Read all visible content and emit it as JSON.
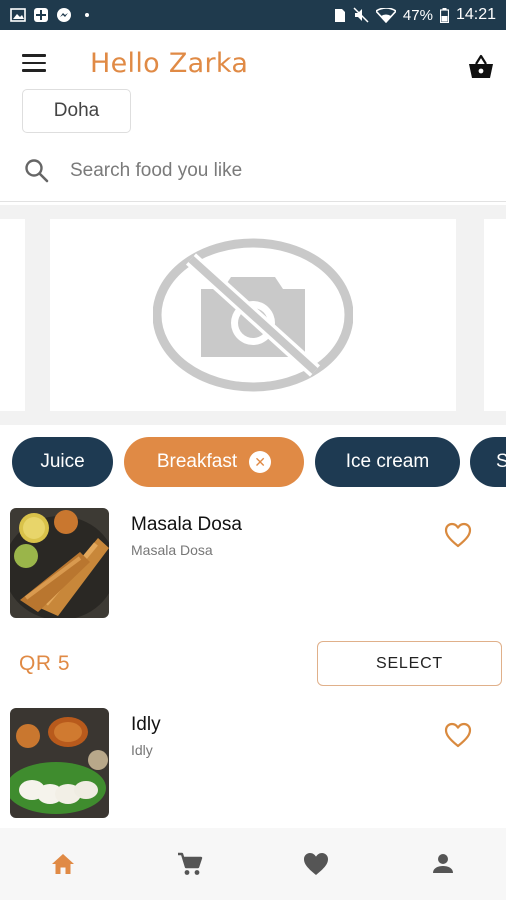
{
  "status_bar": {
    "battery": "47%",
    "time": "14:21"
  },
  "header": {
    "greeting": "Hello Zarka"
  },
  "location": {
    "label": "Doha"
  },
  "search": {
    "placeholder": "Search food you like"
  },
  "categories": [
    {
      "label": "Juice",
      "active": false
    },
    {
      "label": "Breakfast",
      "active": true
    },
    {
      "label": "Ice cream",
      "active": false
    },
    {
      "label": "S",
      "active": false
    }
  ],
  "products": [
    {
      "name": "Masala Dosa",
      "subtitle": "Masala Dosa",
      "price": "QR 5",
      "select_label": "SELECT"
    },
    {
      "name": "Idly",
      "subtitle": "Idly"
    }
  ],
  "bottom_nav": [
    {
      "icon": "home-icon",
      "active": true
    },
    {
      "icon": "cart-icon",
      "active": false
    },
    {
      "icon": "heart-icon",
      "active": false
    },
    {
      "icon": "person-icon",
      "active": false
    }
  ],
  "colors": {
    "accent": "#e08a45",
    "navy": "#1e3a52",
    "status_bar": "#1f3a4d"
  }
}
